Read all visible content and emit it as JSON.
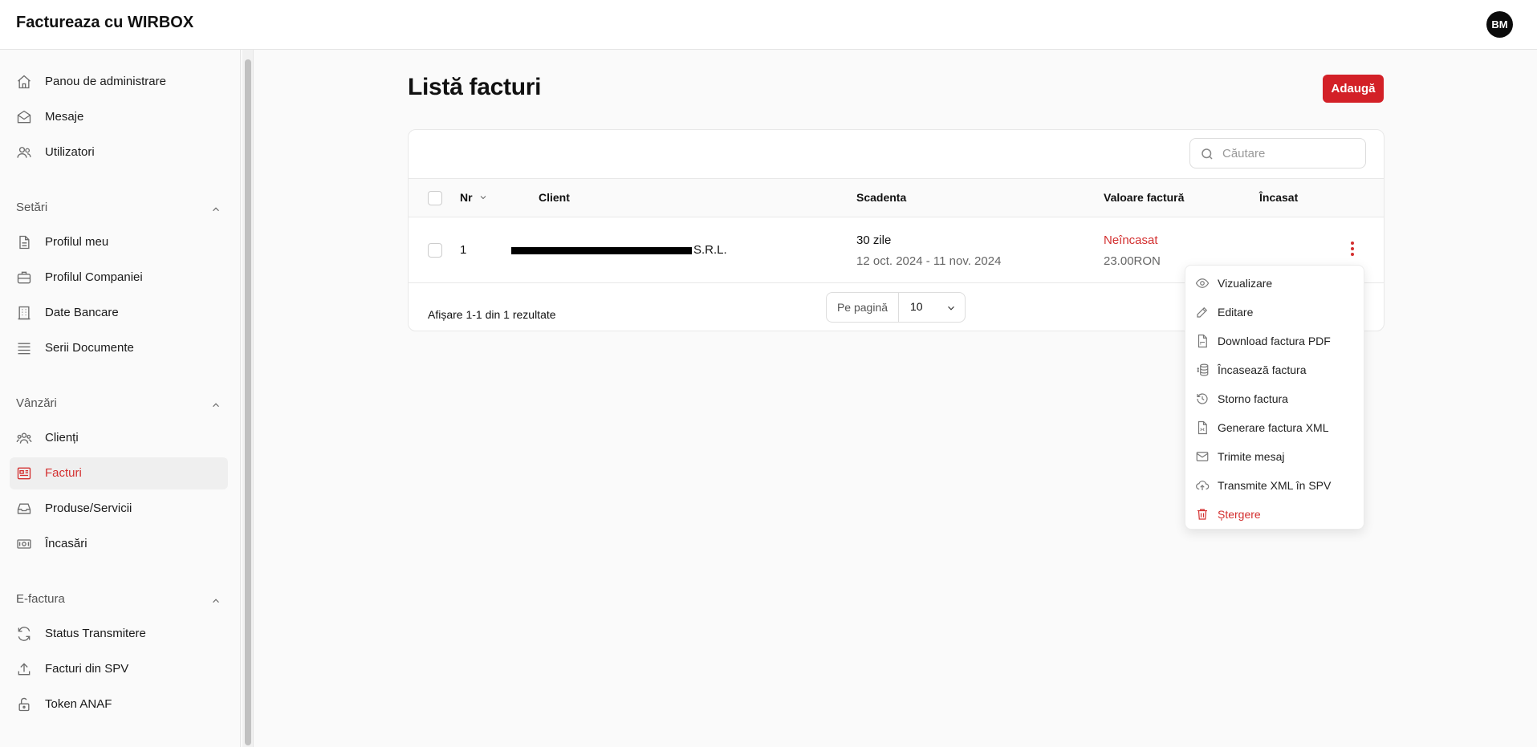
{
  "app": {
    "title": "Factureaza cu WIRBOX",
    "user_initials": "BM"
  },
  "sidebar": {
    "top_items": [
      {
        "label": "Panou de administrare",
        "icon": "home-icon"
      },
      {
        "label": "Mesaje",
        "icon": "mail-icon"
      },
      {
        "label": "Utilizatori",
        "icon": "users-icon"
      }
    ],
    "sections": [
      {
        "title": "Setări",
        "items": [
          {
            "label": "Profilul meu",
            "icon": "document-icon"
          },
          {
            "label": "Profilul Companiei",
            "icon": "briefcase-icon"
          },
          {
            "label": "Date Bancare",
            "icon": "bank-icon"
          },
          {
            "label": "Serii Documente",
            "icon": "list-icon"
          }
        ]
      },
      {
        "title": "Vânzări",
        "items": [
          {
            "label": "Clienți",
            "icon": "users-group-icon"
          },
          {
            "label": "Facturi",
            "icon": "invoice-icon",
            "active": true
          },
          {
            "label": "Produse/Servicii",
            "icon": "inbox-icon"
          },
          {
            "label": "Încasări",
            "icon": "cash-icon"
          }
        ]
      },
      {
        "title": "E-factura",
        "items": [
          {
            "label": "Status Transmitere",
            "icon": "refresh-icon"
          },
          {
            "label": "Facturi din SPV",
            "icon": "upload-icon"
          },
          {
            "label": "Token ANAF",
            "icon": "lock-icon"
          }
        ]
      }
    ]
  },
  "page": {
    "title": "Listă facturi",
    "add_label": "Adaugă"
  },
  "search": {
    "placeholder": "Căutare"
  },
  "table": {
    "columns": {
      "nr": "Nr",
      "client": "Client",
      "due": "Scadenta",
      "value": "Valoare factură",
      "collected": "Încasat"
    },
    "rows": [
      {
        "nr": "1",
        "client_visible": "S.R.L.",
        "due_days": "30 zile",
        "due_range": "12 oct. 2024 - 11 nov. 2024",
        "status": "Neîncasat",
        "amount": "23.00RON"
      }
    ]
  },
  "footer": {
    "summary": "Afișare 1-1 din 1 rezultate",
    "per_page_label": "Pe pagină",
    "per_page_value": "10"
  },
  "actions_menu": [
    {
      "label": "Vizualizare",
      "icon": "eye-icon"
    },
    {
      "label": "Editare",
      "icon": "edit-icon"
    },
    {
      "label": "Download factura PDF",
      "icon": "pdf-file-icon"
    },
    {
      "label": "Încasează factura",
      "icon": "cash-stack-icon"
    },
    {
      "label": "Storno factura",
      "icon": "history-icon"
    },
    {
      "label": "Generare factura XML",
      "icon": "xml-file-icon"
    },
    {
      "label": "Trimite mesaj",
      "icon": "send-mail-icon"
    },
    {
      "label": "Transmite XML în SPV",
      "icon": "cloud-upload-icon"
    },
    {
      "label": "Ștergere",
      "icon": "trash-icon",
      "danger": true
    }
  ],
  "colors": {
    "accent": "#d32027",
    "danger": "#d32f2f"
  }
}
